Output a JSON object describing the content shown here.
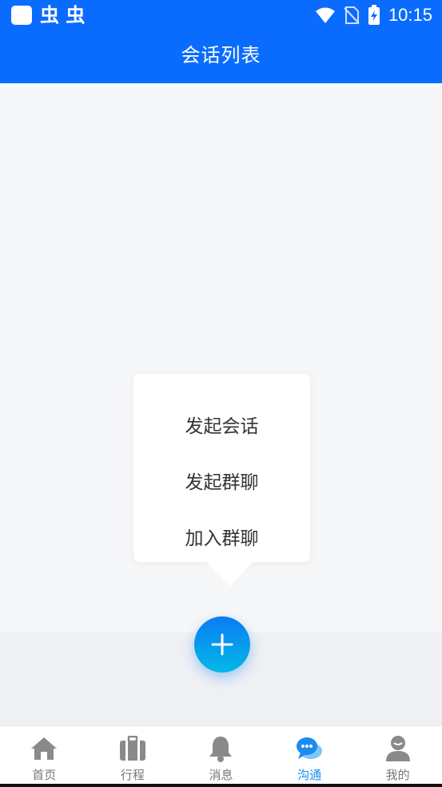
{
  "status_bar": {
    "app_glyphs": "虫 虫",
    "time": "10:15",
    "icons": [
      "app-square-icon",
      "wifi-icon",
      "no-sim-icon",
      "battery-charging-icon"
    ]
  },
  "header": {
    "title": "会话列表"
  },
  "popover_menu": {
    "items": [
      {
        "label": "发起会话"
      },
      {
        "label": "发起群聊"
      },
      {
        "label": "加入群聊"
      }
    ]
  },
  "fab": {
    "icon": "plus-icon"
  },
  "tabbar": {
    "active_color": "#1a8cf0",
    "tabs": [
      {
        "label": "首页",
        "icon": "home-icon"
      },
      {
        "label": "行程",
        "icon": "luggage-icon"
      },
      {
        "label": "消息",
        "icon": "bell-icon"
      },
      {
        "label": "沟通",
        "icon": "chat-bubbles-icon",
        "active": true
      },
      {
        "label": "我的",
        "icon": "user-icon"
      }
    ]
  },
  "colors": {
    "brand": "#0a6cff",
    "inactive": "#777777"
  }
}
